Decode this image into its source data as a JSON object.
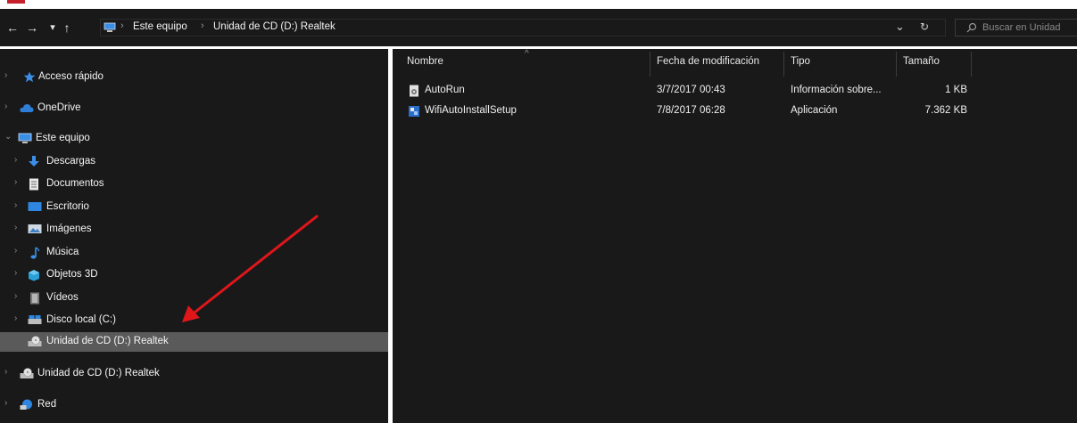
{
  "addressbar": {
    "back": "←",
    "forward": "→",
    "recent": "▾",
    "up": "↑",
    "breadcrumbs": [
      "Este equipo",
      "Unidad de CD (D:) Realtek"
    ],
    "dropdown": "⌄",
    "refresh": "↻"
  },
  "search": {
    "placeholder": "Buscar en Unidad"
  },
  "navpane": {
    "items": [
      {
        "label": "Acceso rápido",
        "icon": "star-icon"
      },
      {
        "label": "OneDrive",
        "icon": "cloud-icon"
      },
      {
        "label": "Este equipo",
        "icon": "computer-icon"
      },
      {
        "label": "Descargas",
        "icon": "download-icon"
      },
      {
        "label": "Documentos",
        "icon": "document-icon"
      },
      {
        "label": "Escritorio",
        "icon": "desktop-icon"
      },
      {
        "label": "Imágenes",
        "icon": "pictures-icon"
      },
      {
        "label": "Música",
        "icon": "music-icon"
      },
      {
        "label": "Objetos 3D",
        "icon": "objects-3d-icon"
      },
      {
        "label": "Vídeos",
        "icon": "videos-icon"
      },
      {
        "label": "Disco local (C:)",
        "icon": "local-disk-icon"
      },
      {
        "label": "Unidad de CD (D:) Realtek",
        "icon": "cd-drive-icon"
      },
      {
        "label": "Unidad de CD (D:) Realtek",
        "icon": "cd-drive-icon"
      },
      {
        "label": "Red",
        "icon": "network-icon"
      }
    ]
  },
  "content": {
    "columns": [
      "Nombre",
      "Fecha de modificación",
      "Tipo",
      "Tamaño"
    ],
    "rows": [
      {
        "name": "AutoRun",
        "date": "3/7/2017 00:43",
        "type": "Información sobre...",
        "size": "1 KB"
      },
      {
        "name": "WifiAutoInstallSetup",
        "date": "7/8/2017 06:28",
        "type": "Aplicación",
        "size": "7.362 KB"
      }
    ]
  },
  "colors": {
    "background": "#191919",
    "selection": "#5a5a5a",
    "arrow": "#e0161b",
    "accent": "#c5202b"
  }
}
